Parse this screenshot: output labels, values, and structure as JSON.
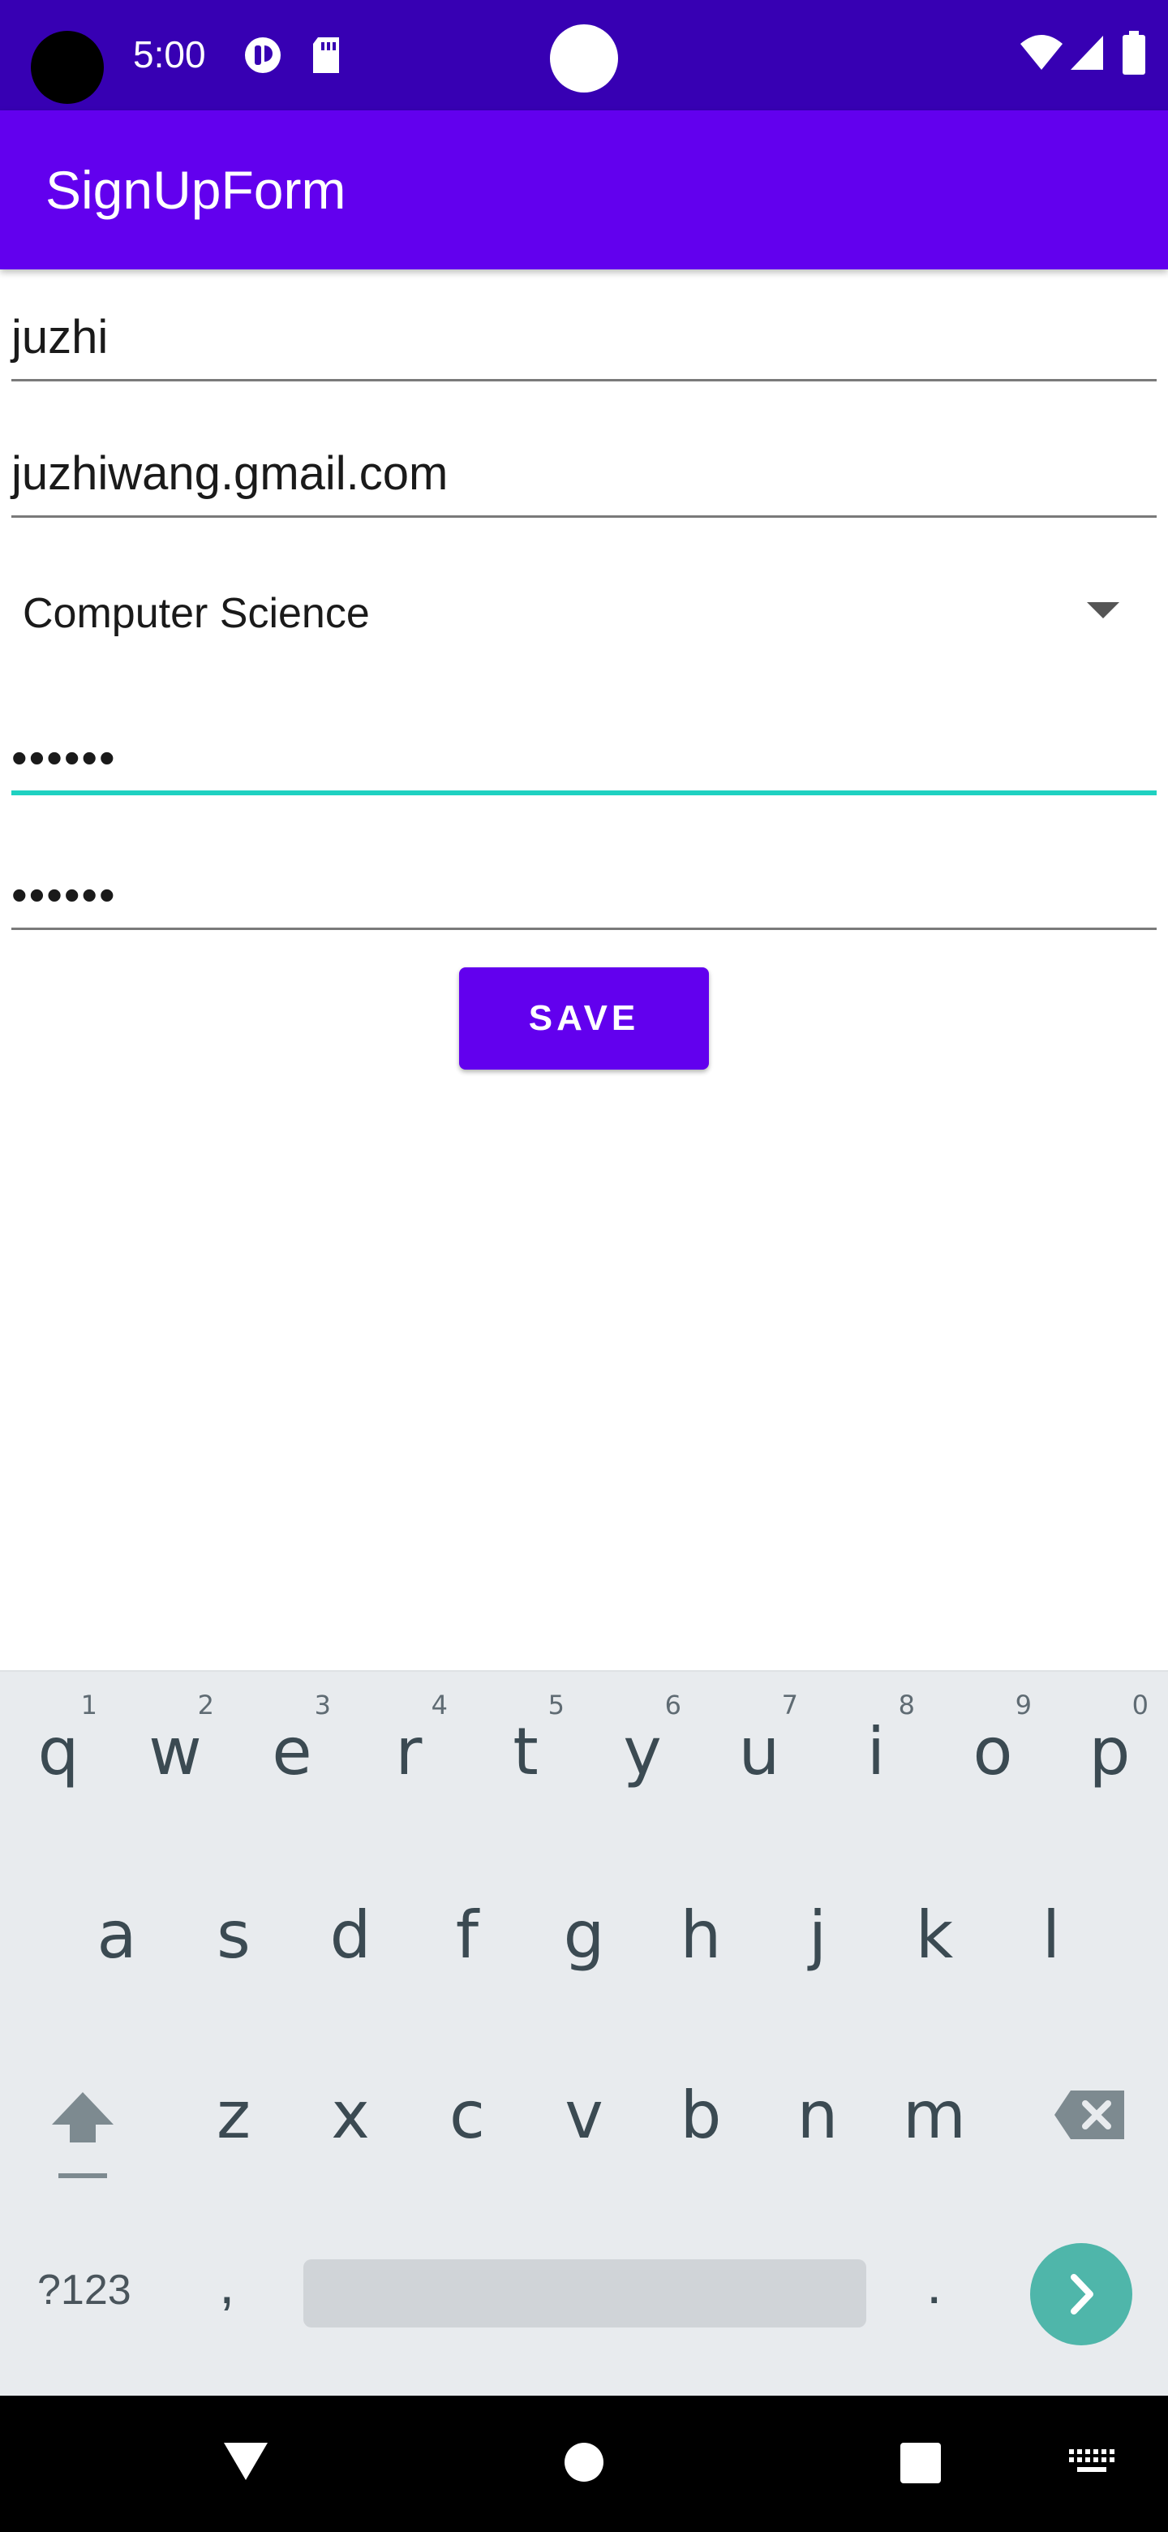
{
  "status_bar": {
    "time": "5:00",
    "icons": [
      "app-notification-icon",
      "sd-card-icon",
      "wifi-icon",
      "cell-signal-icon",
      "battery-icon"
    ]
  },
  "app_bar": {
    "title": "SignUpForm"
  },
  "form": {
    "username": "juzhi",
    "email": "juzhiwang.gmail.com",
    "major": "Computer Science",
    "password": "••••••",
    "confirm_password": "••••••",
    "save_label": "SAVE"
  },
  "keyboard": {
    "row1": [
      {
        "key": "q",
        "num": "1"
      },
      {
        "key": "w",
        "num": "2"
      },
      {
        "key": "e",
        "num": "3"
      },
      {
        "key": "r",
        "num": "4"
      },
      {
        "key": "t",
        "num": "5"
      },
      {
        "key": "y",
        "num": "6"
      },
      {
        "key": "u",
        "num": "7"
      },
      {
        "key": "i",
        "num": "8"
      },
      {
        "key": "o",
        "num": "9"
      },
      {
        "key": "p",
        "num": "0"
      }
    ],
    "row2": [
      "a",
      "s",
      "d",
      "f",
      "g",
      "h",
      "j",
      "k",
      "l"
    ],
    "row3": [
      "z",
      "x",
      "c",
      "v",
      "b",
      "n",
      "m"
    ],
    "symbols_label": "?123",
    "comma_label": ",",
    "period_label": "."
  },
  "colors": {
    "status_bar": "#3700b3",
    "primary": "#6200ee",
    "focus_accent": "#1fd1c1",
    "keyboard_bg": "#e8ebee",
    "go_key": "#4fb6aa"
  }
}
